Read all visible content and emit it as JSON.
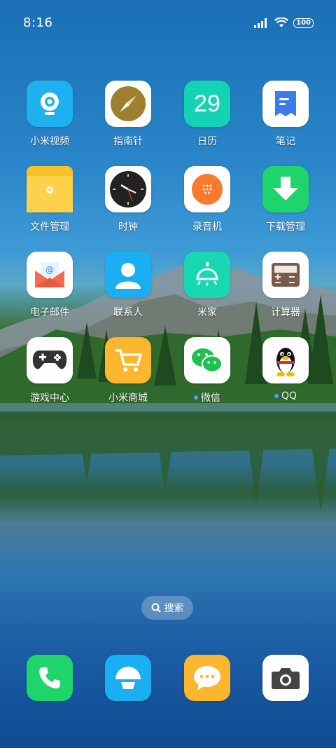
{
  "status": {
    "time": "8:16",
    "battery": "100"
  },
  "apps": [
    {
      "label": "小米视频"
    },
    {
      "label": "指南针"
    },
    {
      "label": "日历",
      "date": "29"
    },
    {
      "label": "笔记"
    },
    {
      "label": "文件管理"
    },
    {
      "label": "时钟"
    },
    {
      "label": "录音机"
    },
    {
      "label": "下载管理"
    },
    {
      "label": "电子邮件"
    },
    {
      "label": "联系人"
    },
    {
      "label": "米家"
    },
    {
      "label": "计算器"
    },
    {
      "label": "游戏中心"
    },
    {
      "label": "小米商城"
    },
    {
      "label": "微信",
      "badge": true
    },
    {
      "label": "QQ",
      "badge": true
    }
  ],
  "search": {
    "label": "搜索"
  }
}
